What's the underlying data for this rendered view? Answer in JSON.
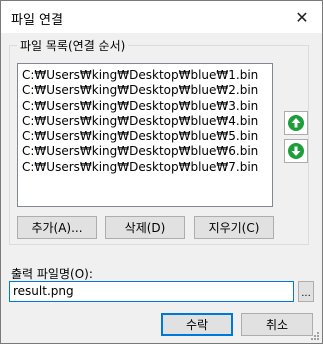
{
  "window": {
    "title": "파일 연결",
    "close_icon": "close-icon"
  },
  "group": {
    "label": "파일 목록(연결 순서)"
  },
  "files": [
    "C:₩Users₩king₩Desktop₩blue₩1.bin",
    "C:₩Users₩king₩Desktop₩blue₩2.bin",
    "C:₩Users₩king₩Desktop₩blue₩3.bin",
    "C:₩Users₩king₩Desktop₩blue₩4.bin",
    "C:₩Users₩king₩Desktop₩blue₩5.bin",
    "C:₩Users₩king₩Desktop₩blue₩6.bin",
    "C:₩Users₩king₩Desktop₩blue₩7.bin"
  ],
  "side_buttons": {
    "up_icon": "arrow-up-icon",
    "down_icon": "arrow-down-icon"
  },
  "buttons": {
    "add": "추가(A)...",
    "delete": "삭제(D)",
    "clear": "지우기(C)",
    "ok": "수락",
    "cancel": "취소",
    "browse": "..."
  },
  "output": {
    "label": "출력 파일명(O):",
    "value": "result.png"
  },
  "colors": {
    "accent": "#0078d7",
    "arrow_green": "#1e9e3a"
  }
}
